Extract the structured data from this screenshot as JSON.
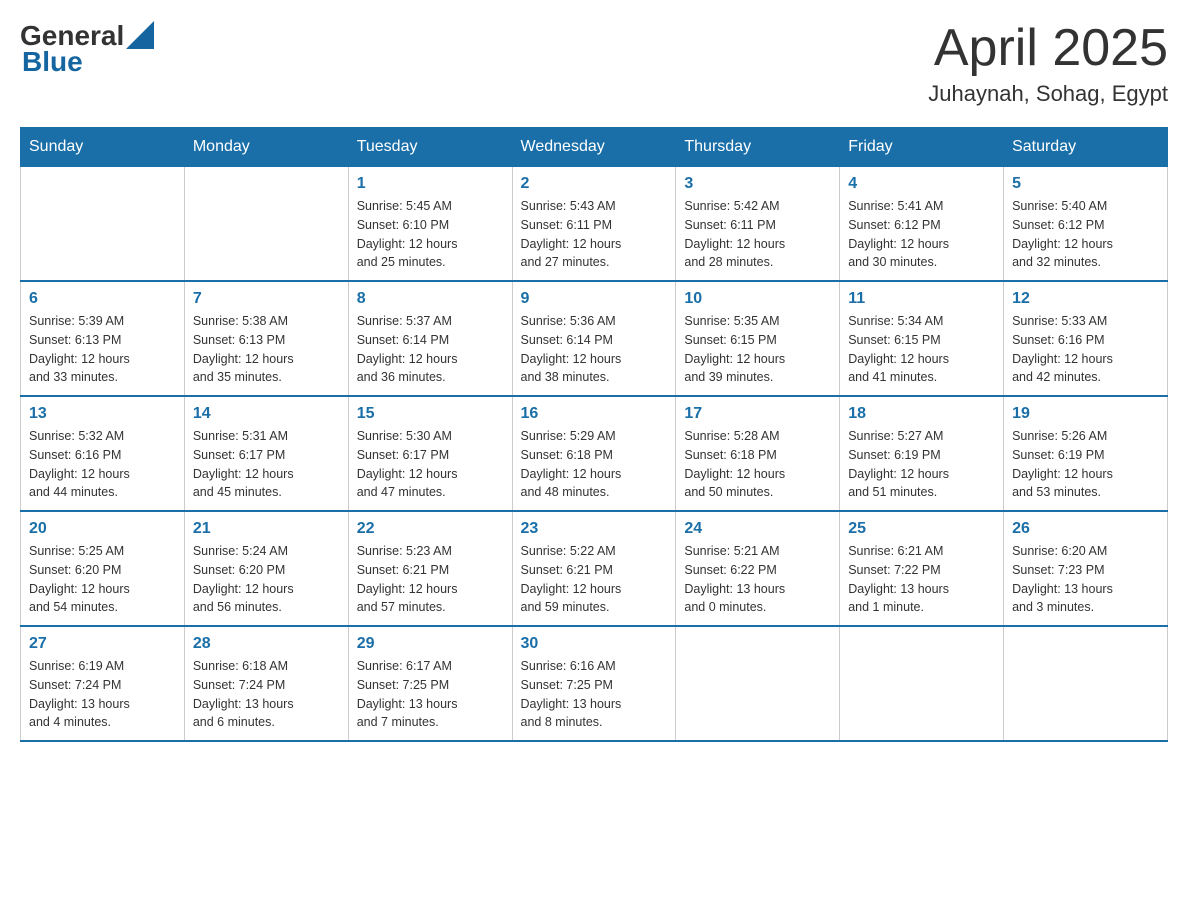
{
  "header": {
    "logo_general": "General",
    "logo_blue": "Blue",
    "title": "April 2025",
    "location": "Juhaynah, Sohag, Egypt"
  },
  "days_of_week": [
    "Sunday",
    "Monday",
    "Tuesday",
    "Wednesday",
    "Thursday",
    "Friday",
    "Saturday"
  ],
  "weeks": [
    [
      {
        "day": "",
        "info": ""
      },
      {
        "day": "",
        "info": ""
      },
      {
        "day": "1",
        "info": "Sunrise: 5:45 AM\nSunset: 6:10 PM\nDaylight: 12 hours\nand 25 minutes."
      },
      {
        "day": "2",
        "info": "Sunrise: 5:43 AM\nSunset: 6:11 PM\nDaylight: 12 hours\nand 27 minutes."
      },
      {
        "day": "3",
        "info": "Sunrise: 5:42 AM\nSunset: 6:11 PM\nDaylight: 12 hours\nand 28 minutes."
      },
      {
        "day": "4",
        "info": "Sunrise: 5:41 AM\nSunset: 6:12 PM\nDaylight: 12 hours\nand 30 minutes."
      },
      {
        "day": "5",
        "info": "Sunrise: 5:40 AM\nSunset: 6:12 PM\nDaylight: 12 hours\nand 32 minutes."
      }
    ],
    [
      {
        "day": "6",
        "info": "Sunrise: 5:39 AM\nSunset: 6:13 PM\nDaylight: 12 hours\nand 33 minutes."
      },
      {
        "day": "7",
        "info": "Sunrise: 5:38 AM\nSunset: 6:13 PM\nDaylight: 12 hours\nand 35 minutes."
      },
      {
        "day": "8",
        "info": "Sunrise: 5:37 AM\nSunset: 6:14 PM\nDaylight: 12 hours\nand 36 minutes."
      },
      {
        "day": "9",
        "info": "Sunrise: 5:36 AM\nSunset: 6:14 PM\nDaylight: 12 hours\nand 38 minutes."
      },
      {
        "day": "10",
        "info": "Sunrise: 5:35 AM\nSunset: 6:15 PM\nDaylight: 12 hours\nand 39 minutes."
      },
      {
        "day": "11",
        "info": "Sunrise: 5:34 AM\nSunset: 6:15 PM\nDaylight: 12 hours\nand 41 minutes."
      },
      {
        "day": "12",
        "info": "Sunrise: 5:33 AM\nSunset: 6:16 PM\nDaylight: 12 hours\nand 42 minutes."
      }
    ],
    [
      {
        "day": "13",
        "info": "Sunrise: 5:32 AM\nSunset: 6:16 PM\nDaylight: 12 hours\nand 44 minutes."
      },
      {
        "day": "14",
        "info": "Sunrise: 5:31 AM\nSunset: 6:17 PM\nDaylight: 12 hours\nand 45 minutes."
      },
      {
        "day": "15",
        "info": "Sunrise: 5:30 AM\nSunset: 6:17 PM\nDaylight: 12 hours\nand 47 minutes."
      },
      {
        "day": "16",
        "info": "Sunrise: 5:29 AM\nSunset: 6:18 PM\nDaylight: 12 hours\nand 48 minutes."
      },
      {
        "day": "17",
        "info": "Sunrise: 5:28 AM\nSunset: 6:18 PM\nDaylight: 12 hours\nand 50 minutes."
      },
      {
        "day": "18",
        "info": "Sunrise: 5:27 AM\nSunset: 6:19 PM\nDaylight: 12 hours\nand 51 minutes."
      },
      {
        "day": "19",
        "info": "Sunrise: 5:26 AM\nSunset: 6:19 PM\nDaylight: 12 hours\nand 53 minutes."
      }
    ],
    [
      {
        "day": "20",
        "info": "Sunrise: 5:25 AM\nSunset: 6:20 PM\nDaylight: 12 hours\nand 54 minutes."
      },
      {
        "day": "21",
        "info": "Sunrise: 5:24 AM\nSunset: 6:20 PM\nDaylight: 12 hours\nand 56 minutes."
      },
      {
        "day": "22",
        "info": "Sunrise: 5:23 AM\nSunset: 6:21 PM\nDaylight: 12 hours\nand 57 minutes."
      },
      {
        "day": "23",
        "info": "Sunrise: 5:22 AM\nSunset: 6:21 PM\nDaylight: 12 hours\nand 59 minutes."
      },
      {
        "day": "24",
        "info": "Sunrise: 5:21 AM\nSunset: 6:22 PM\nDaylight: 13 hours\nand 0 minutes."
      },
      {
        "day": "25",
        "info": "Sunrise: 6:21 AM\nSunset: 7:22 PM\nDaylight: 13 hours\nand 1 minute."
      },
      {
        "day": "26",
        "info": "Sunrise: 6:20 AM\nSunset: 7:23 PM\nDaylight: 13 hours\nand 3 minutes."
      }
    ],
    [
      {
        "day": "27",
        "info": "Sunrise: 6:19 AM\nSunset: 7:24 PM\nDaylight: 13 hours\nand 4 minutes."
      },
      {
        "day": "28",
        "info": "Sunrise: 6:18 AM\nSunset: 7:24 PM\nDaylight: 13 hours\nand 6 minutes."
      },
      {
        "day": "29",
        "info": "Sunrise: 6:17 AM\nSunset: 7:25 PM\nDaylight: 13 hours\nand 7 minutes."
      },
      {
        "day": "30",
        "info": "Sunrise: 6:16 AM\nSunset: 7:25 PM\nDaylight: 13 hours\nand 8 minutes."
      },
      {
        "day": "",
        "info": ""
      },
      {
        "day": "",
        "info": ""
      },
      {
        "day": "",
        "info": ""
      }
    ]
  ]
}
